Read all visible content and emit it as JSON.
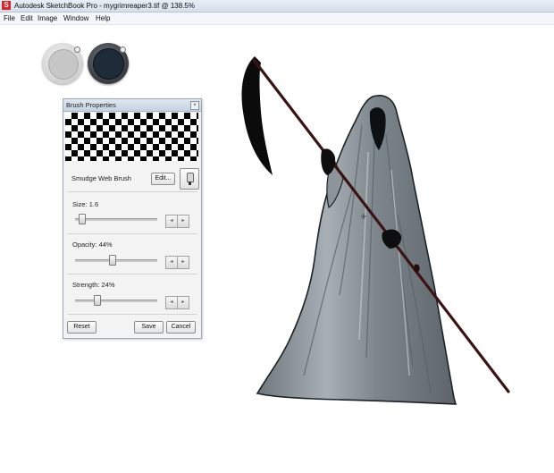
{
  "window": {
    "title": "Autodesk SketchBook Pro - mygrimreaper3.tif @ 138.5%",
    "app_icon_label": "S",
    "app_icon_color": "#d8262a"
  },
  "menu": {
    "items": [
      "File",
      "Edit",
      "Image",
      "Window",
      "Help"
    ]
  },
  "pucks": {
    "left": {
      "icon": "lagoon-puck-light"
    },
    "right": {
      "icon": "color-puck-dark",
      "color": "#1d2c38"
    }
  },
  "brush_panel": {
    "title": "Brush Properties",
    "close_glyph": "×",
    "brush_name": "Smudge Web Brush",
    "edit_label": "Edit...",
    "size": {
      "label": "Size: 1.6",
      "fraction": 0.05
    },
    "opacity": {
      "label": "Opacity: 44%",
      "fraction": 0.44
    },
    "strength": {
      "label": "Strength: 24%",
      "fraction": 0.24
    },
    "stepper_left": "◂",
    "stepper_right": "▸",
    "reset_label": "Reset",
    "save_label": "Save",
    "cancel_label": "Cancel"
  },
  "colors": {
    "scythe_staff": "#3a1414",
    "robe": "#8a9298",
    "robe_outline": "#1b2226"
  }
}
